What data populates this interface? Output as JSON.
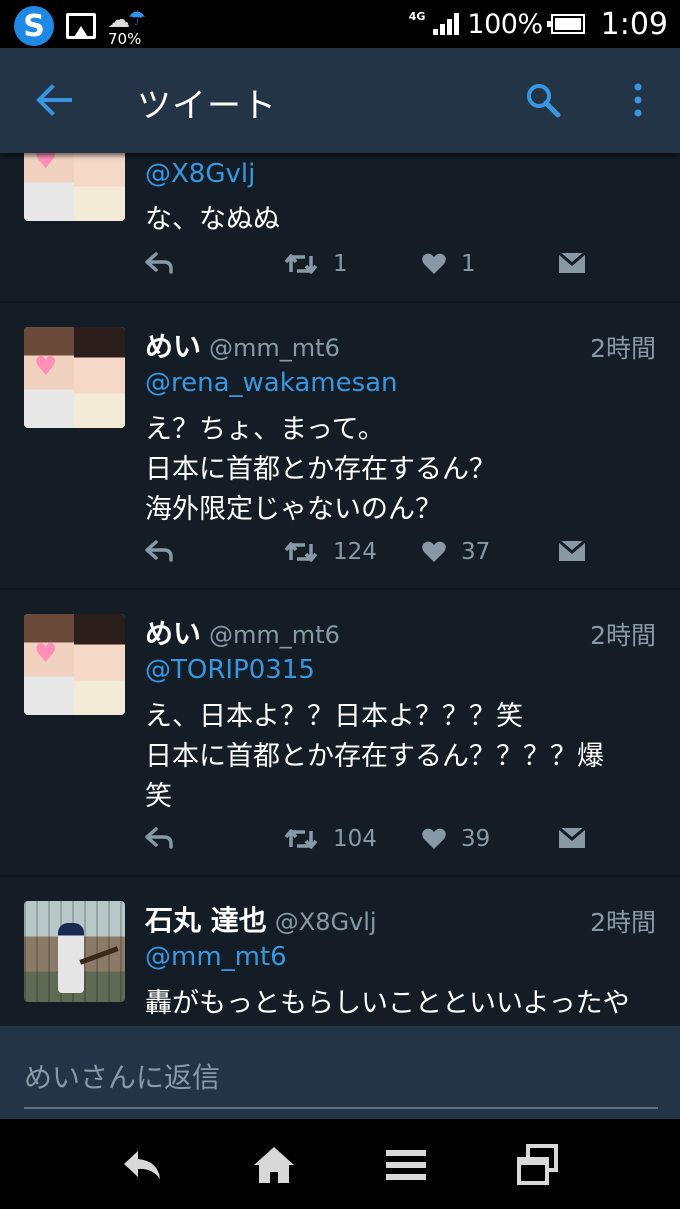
{
  "status_bar": {
    "weather_percent": "70%",
    "network": "4G",
    "battery": "100%",
    "time": "1:09"
  },
  "header": {
    "title": "ツイート"
  },
  "tweets": [
    {
      "mention": "@X8Gvlj",
      "lines": [
        "な、なぬぬ"
      ],
      "retweets": "1",
      "likes": "1"
    },
    {
      "name": "めい",
      "handle": "@mm_mt6",
      "time": "2時間",
      "mention": "@rena_wakamesan",
      "lines": [
        "え？ちょ、まって。",
        "日本に首都とか存在するん？",
        "海外限定じゃないのん？"
      ],
      "retweets": "124",
      "likes": "37"
    },
    {
      "name": "めい",
      "handle": "@mm_mt6",
      "time": "2時間",
      "mention": "@TORIP0315",
      "lines": [
        "え、日本よ？？日本よ？？？笑",
        "日本に首都とか存在するん？？？？爆",
        "笑"
      ],
      "retweets": "104",
      "likes": "39"
    },
    {
      "name": "石丸 達也",
      "handle": "@X8Gvlj",
      "time": "2時間",
      "mention": "@mm_mt6",
      "lines": [
        "轟がもっともらしいことといいよったや"
      ]
    }
  ],
  "reply": {
    "placeholder": "めいさんに返信"
  },
  "icons": {
    "back": "arrow-left-icon",
    "search": "search-icon",
    "more": "more-vertical-icon",
    "reply": "reply-icon",
    "retweet": "retweet-icon",
    "like": "heart-icon",
    "dm": "direct-message-icon"
  },
  "colors": {
    "background": "#141d26",
    "header": "#243447",
    "accent": "#3897e0",
    "muted": "#8899a6"
  }
}
